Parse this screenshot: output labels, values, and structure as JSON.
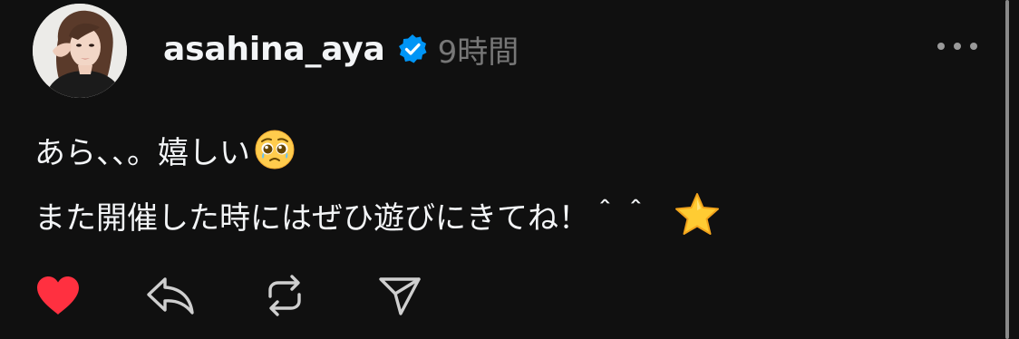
{
  "post": {
    "username": "asahina_aya",
    "verified": true,
    "timestamp": "9時間",
    "text_line1": "あら、、。嬉しい",
    "text_line2": "また開催した時にはぜひ遊びにきてね！＾＾",
    "emoji_line1": "pleading-face-emoji",
    "emoji_line2": "star-emoji",
    "liked": true
  },
  "icons": {
    "more": "more-horizontal-icon",
    "like": "heart-icon",
    "reply": "reply-icon",
    "repost": "repost-icon",
    "share": "send-icon",
    "verified": "verified-badge-icon"
  },
  "colors": {
    "background": "#101010",
    "text": "#f3f5f7",
    "muted": "#777777",
    "like": "#ff3040",
    "verified": "#0095f6"
  }
}
